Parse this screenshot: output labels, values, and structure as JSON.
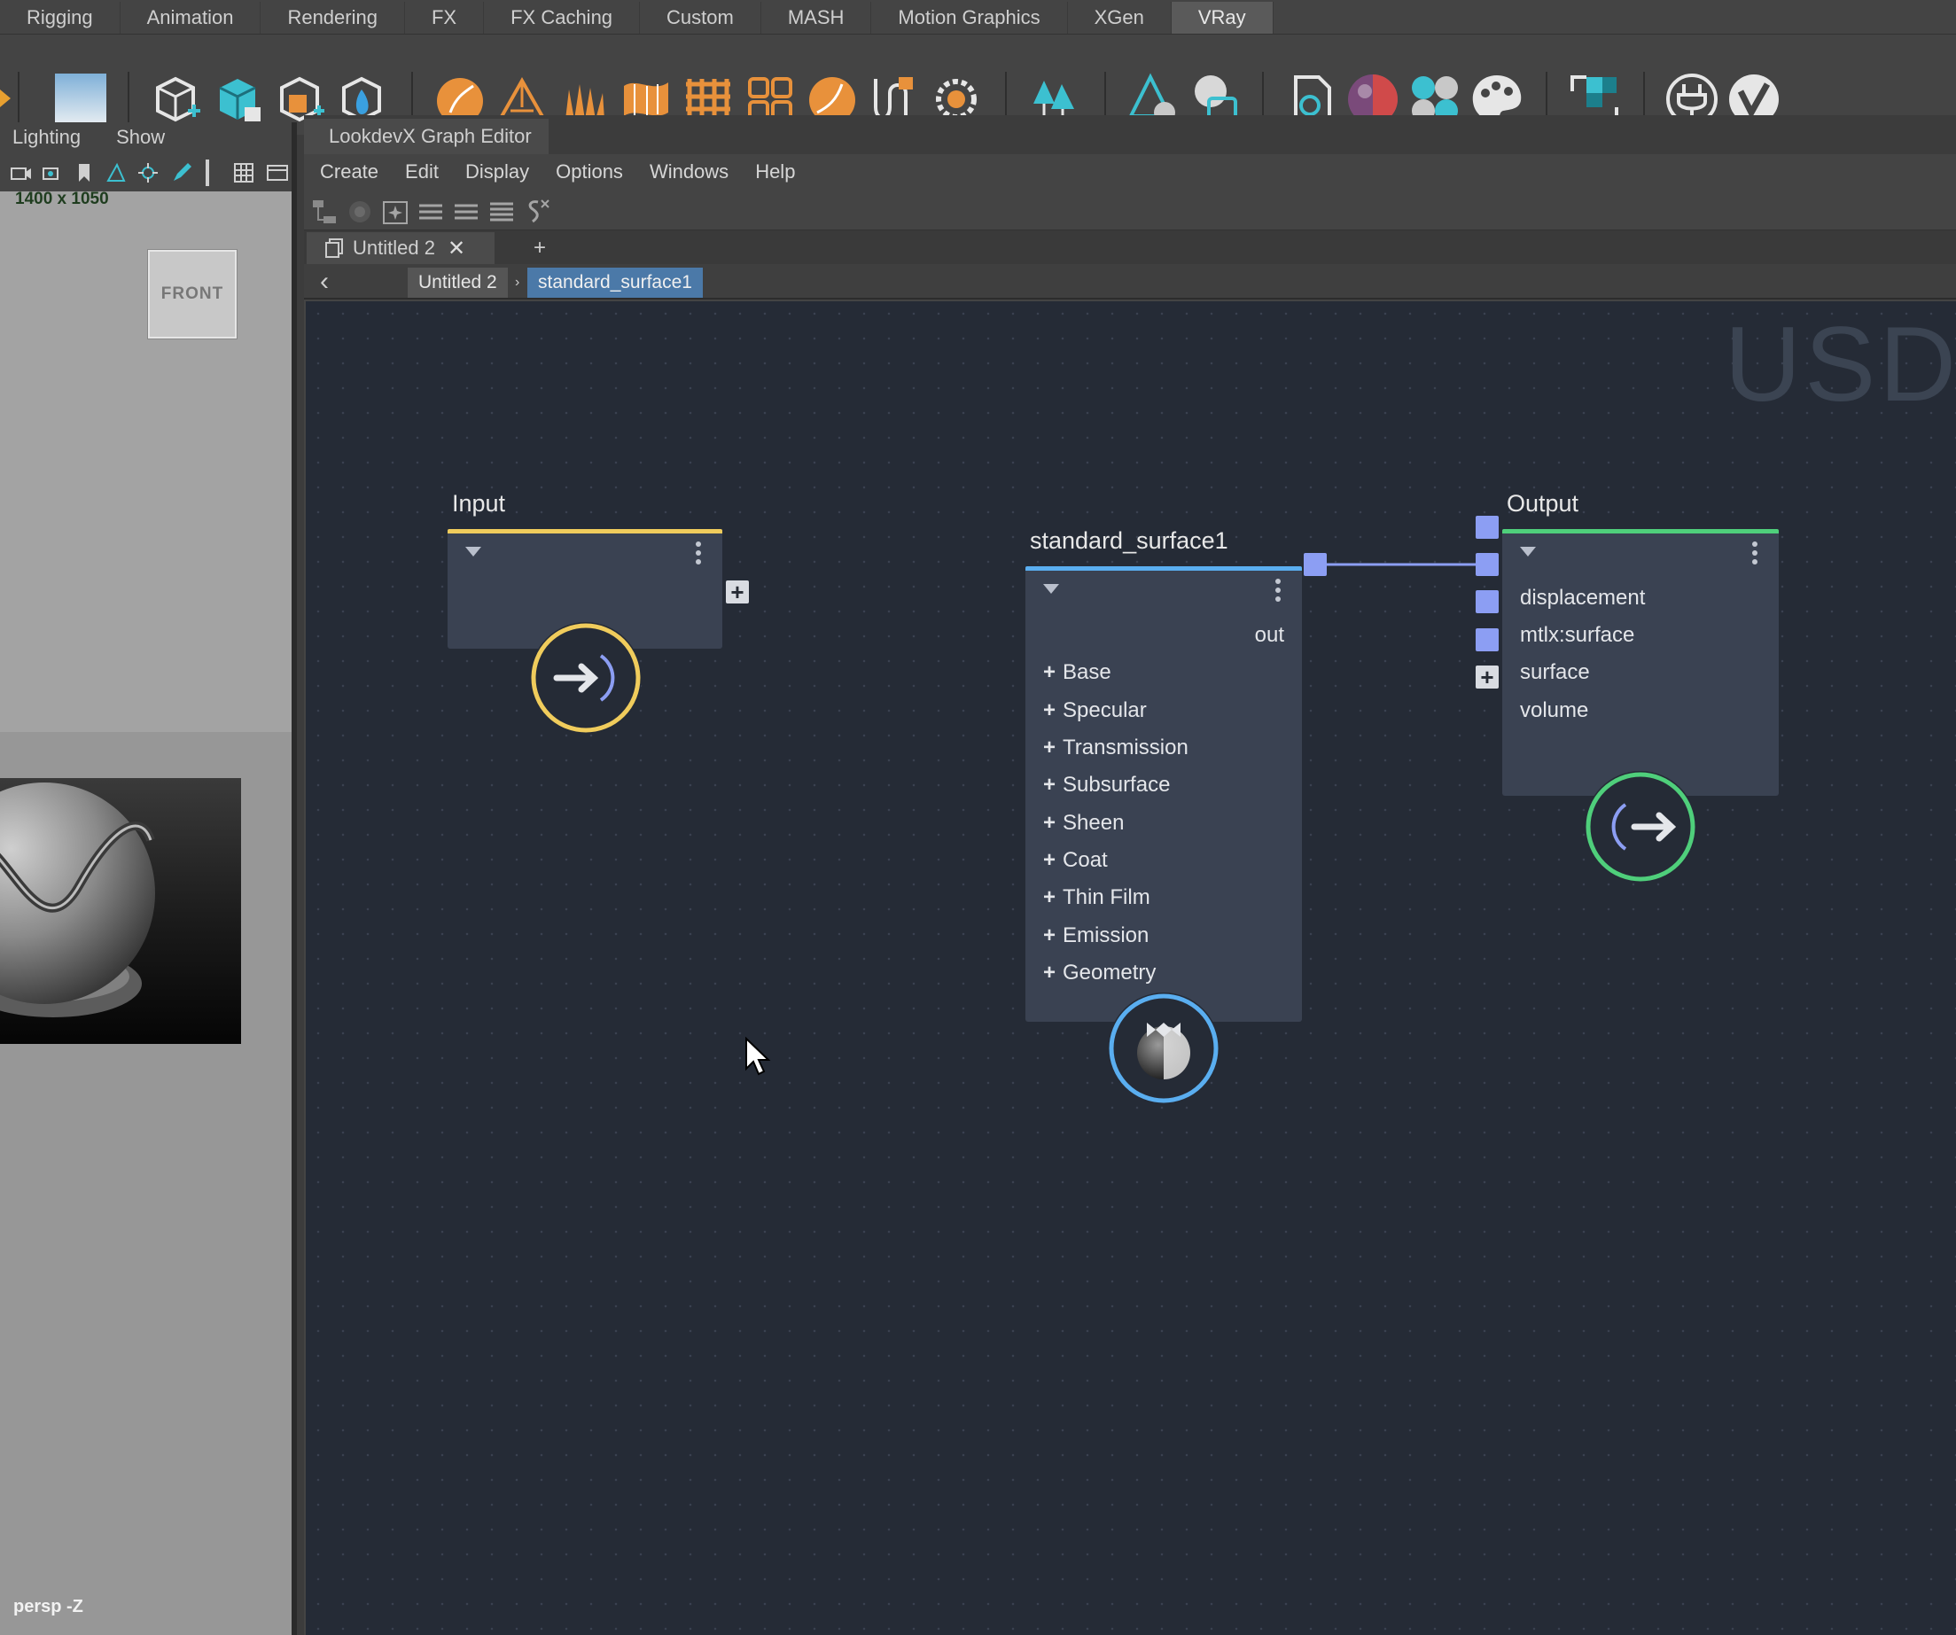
{
  "shelf": {
    "tabs": [
      "Rigging",
      "Animation",
      "Rendering",
      "FX",
      "FX Caching",
      "Custom",
      "MASH",
      "Motion Graphics",
      "XGen",
      "VRay"
    ],
    "active_tab": "VRay"
  },
  "viewport": {
    "menu": [
      "Lighting",
      "Show"
    ],
    "resolution": "1400 x 1050",
    "view_cube_label": "FRONT",
    "camera_label": "persp -Z"
  },
  "graph_editor": {
    "title": "LookdevX Graph Editor",
    "menu": [
      "Create",
      "Edit",
      "Display",
      "Options",
      "Windows",
      "Help"
    ],
    "tab_label": "Untitled 2",
    "add_tab_label": "+",
    "breadcrumb": [
      "Untitled 2",
      "standard_surface1"
    ],
    "watermark": "USD",
    "nodes": {
      "input": {
        "title": "Input"
      },
      "standard_surface": {
        "title": "standard_surface1",
        "output_port": "out",
        "groups": [
          "Base",
          "Specular",
          "Transmission",
          "Subsurface",
          "Sheen",
          "Coat",
          "Thin Film",
          "Emission",
          "Geometry"
        ]
      },
      "output": {
        "title": "Output",
        "ports": [
          "displacement",
          "mtlx:surface",
          "surface",
          "volume"
        ]
      }
    },
    "colors": {
      "input_accent": "#f0cc5c",
      "surface_accent": "#5aaef0",
      "output_accent": "#4fcf7b",
      "port": "#8c9ef3",
      "connection": "#8c9ef3"
    }
  }
}
